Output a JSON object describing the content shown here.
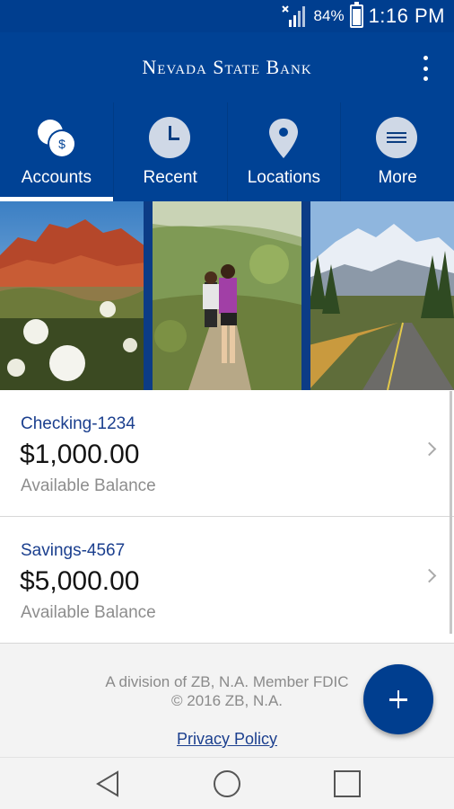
{
  "status_bar": {
    "battery_percent": "84%",
    "battery_level": 0.84,
    "time": "1:16 PM"
  },
  "app_bar": {
    "title": "Nevada State Bank",
    "overflow_icon": "more-vert-icon"
  },
  "tabs": [
    {
      "label": "Accounts",
      "icon": "accounts-coins-icon",
      "active": true
    },
    {
      "label": "Recent",
      "icon": "clock-icon",
      "active": false
    },
    {
      "label": "Locations",
      "icon": "location-pin-icon",
      "active": false
    },
    {
      "label": "More",
      "icon": "menu-icon",
      "active": false
    }
  ],
  "photos": [
    {
      "subject": "red-rock-desert-with-white-flowers"
    },
    {
      "subject": "hikers-on-trail"
    },
    {
      "subject": "snowy-mountain-road"
    }
  ],
  "accounts": [
    {
      "name": "Checking-1234",
      "balance": "$1,000.00",
      "balance_label": "Available Balance"
    },
    {
      "name": "Savings-4567",
      "balance": "$5,000.00",
      "balance_label": "Available Balance"
    }
  ],
  "footer": {
    "line1": "A division of ZB, N.A. Member FDIC",
    "line2": "© 2016 ZB, N.A.",
    "privacy_link": "Privacy Policy"
  },
  "fab": {
    "icon": "plus-icon"
  },
  "nav_bar": {
    "back_icon": "back-triangle-icon",
    "home_icon": "home-circle-icon",
    "recent_icon": "recents-square-icon"
  },
  "colors": {
    "brand_blue": "#004295",
    "status_blue": "#003e8f",
    "account_name": "#1b3f8e"
  }
}
